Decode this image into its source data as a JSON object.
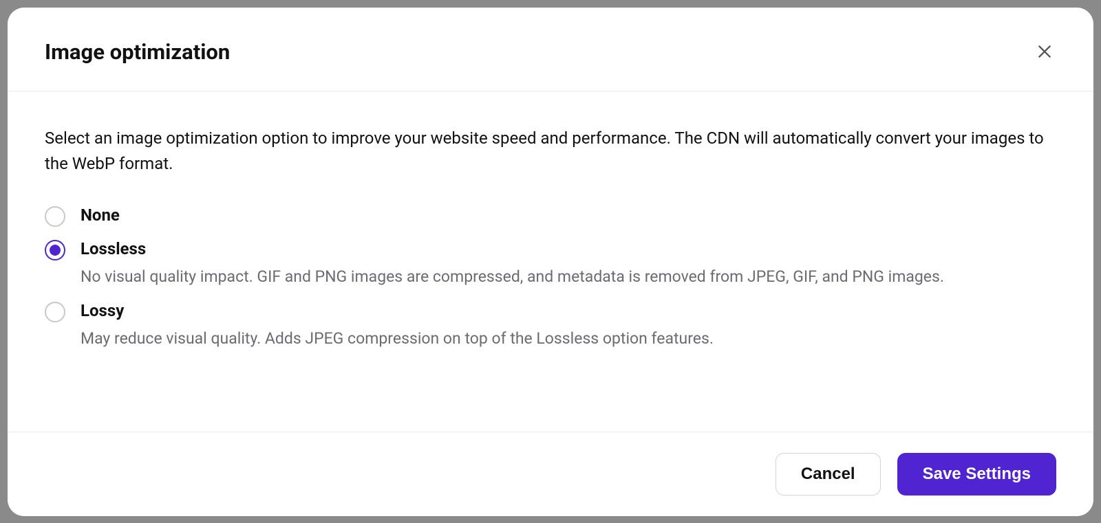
{
  "modal": {
    "title": "Image optimization",
    "description": "Select an image optimization option to improve your website speed and performance. The CDN will automatically convert your images to the WebP format.",
    "options": [
      {
        "id": "none",
        "label": "None",
        "description": "",
        "selected": false
      },
      {
        "id": "lossless",
        "label": "Lossless",
        "description": "No visual quality impact. GIF and PNG images are compressed, and metadata is removed from JPEG, GIF, and PNG images.",
        "selected": true
      },
      {
        "id": "lossy",
        "label": "Lossy",
        "description": "May reduce visual quality. Adds JPEG compression on top of the Lossless option features.",
        "selected": false
      }
    ],
    "footer": {
      "cancel_label": "Cancel",
      "save_label": "Save Settings"
    }
  },
  "colors": {
    "accent": "#5025d1",
    "text_primary": "#111111",
    "text_secondary": "#6b6b73",
    "border": "#ebebeb"
  }
}
